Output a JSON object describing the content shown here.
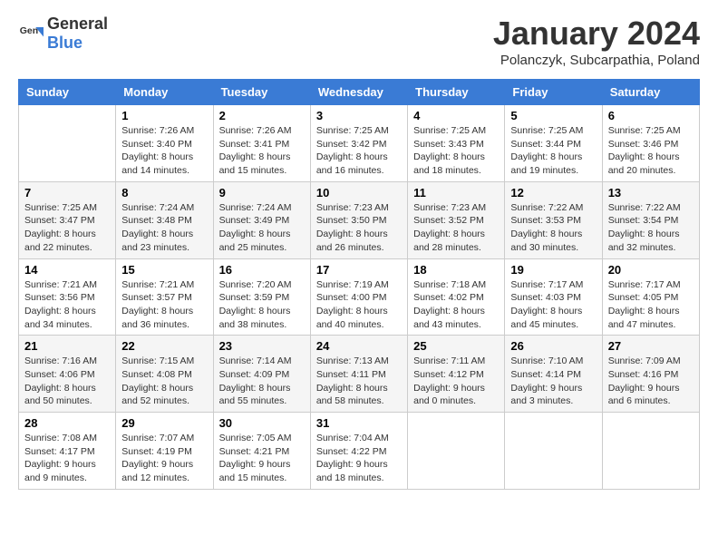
{
  "logo": {
    "general": "General",
    "blue": "Blue"
  },
  "title": {
    "month": "January 2024",
    "location": "Polanczyk, Subcarpathia, Poland"
  },
  "weekdays": [
    "Sunday",
    "Monday",
    "Tuesday",
    "Wednesday",
    "Thursday",
    "Friday",
    "Saturday"
  ],
  "weeks": [
    [
      {
        "day": "",
        "sunrise": "",
        "sunset": "",
        "daylight": ""
      },
      {
        "day": "1",
        "sunrise": "Sunrise: 7:26 AM",
        "sunset": "Sunset: 3:40 PM",
        "daylight": "Daylight: 8 hours and 14 minutes."
      },
      {
        "day": "2",
        "sunrise": "Sunrise: 7:26 AM",
        "sunset": "Sunset: 3:41 PM",
        "daylight": "Daylight: 8 hours and 15 minutes."
      },
      {
        "day": "3",
        "sunrise": "Sunrise: 7:25 AM",
        "sunset": "Sunset: 3:42 PM",
        "daylight": "Daylight: 8 hours and 16 minutes."
      },
      {
        "day": "4",
        "sunrise": "Sunrise: 7:25 AM",
        "sunset": "Sunset: 3:43 PM",
        "daylight": "Daylight: 8 hours and 18 minutes."
      },
      {
        "day": "5",
        "sunrise": "Sunrise: 7:25 AM",
        "sunset": "Sunset: 3:44 PM",
        "daylight": "Daylight: 8 hours and 19 minutes."
      },
      {
        "day": "6",
        "sunrise": "Sunrise: 7:25 AM",
        "sunset": "Sunset: 3:46 PM",
        "daylight": "Daylight: 8 hours and 20 minutes."
      }
    ],
    [
      {
        "day": "7",
        "sunrise": "Sunrise: 7:25 AM",
        "sunset": "Sunset: 3:47 PM",
        "daylight": "Daylight: 8 hours and 22 minutes."
      },
      {
        "day": "8",
        "sunrise": "Sunrise: 7:24 AM",
        "sunset": "Sunset: 3:48 PM",
        "daylight": "Daylight: 8 hours and 23 minutes."
      },
      {
        "day": "9",
        "sunrise": "Sunrise: 7:24 AM",
        "sunset": "Sunset: 3:49 PM",
        "daylight": "Daylight: 8 hours and 25 minutes."
      },
      {
        "day": "10",
        "sunrise": "Sunrise: 7:23 AM",
        "sunset": "Sunset: 3:50 PM",
        "daylight": "Daylight: 8 hours and 26 minutes."
      },
      {
        "day": "11",
        "sunrise": "Sunrise: 7:23 AM",
        "sunset": "Sunset: 3:52 PM",
        "daylight": "Daylight: 8 hours and 28 minutes."
      },
      {
        "day": "12",
        "sunrise": "Sunrise: 7:22 AM",
        "sunset": "Sunset: 3:53 PM",
        "daylight": "Daylight: 8 hours and 30 minutes."
      },
      {
        "day": "13",
        "sunrise": "Sunrise: 7:22 AM",
        "sunset": "Sunset: 3:54 PM",
        "daylight": "Daylight: 8 hours and 32 minutes."
      }
    ],
    [
      {
        "day": "14",
        "sunrise": "Sunrise: 7:21 AM",
        "sunset": "Sunset: 3:56 PM",
        "daylight": "Daylight: 8 hours and 34 minutes."
      },
      {
        "day": "15",
        "sunrise": "Sunrise: 7:21 AM",
        "sunset": "Sunset: 3:57 PM",
        "daylight": "Daylight: 8 hours and 36 minutes."
      },
      {
        "day": "16",
        "sunrise": "Sunrise: 7:20 AM",
        "sunset": "Sunset: 3:59 PM",
        "daylight": "Daylight: 8 hours and 38 minutes."
      },
      {
        "day": "17",
        "sunrise": "Sunrise: 7:19 AM",
        "sunset": "Sunset: 4:00 PM",
        "daylight": "Daylight: 8 hours and 40 minutes."
      },
      {
        "day": "18",
        "sunrise": "Sunrise: 7:18 AM",
        "sunset": "Sunset: 4:02 PM",
        "daylight": "Daylight: 8 hours and 43 minutes."
      },
      {
        "day": "19",
        "sunrise": "Sunrise: 7:17 AM",
        "sunset": "Sunset: 4:03 PM",
        "daylight": "Daylight: 8 hours and 45 minutes."
      },
      {
        "day": "20",
        "sunrise": "Sunrise: 7:17 AM",
        "sunset": "Sunset: 4:05 PM",
        "daylight": "Daylight: 8 hours and 47 minutes."
      }
    ],
    [
      {
        "day": "21",
        "sunrise": "Sunrise: 7:16 AM",
        "sunset": "Sunset: 4:06 PM",
        "daylight": "Daylight: 8 hours and 50 minutes."
      },
      {
        "day": "22",
        "sunrise": "Sunrise: 7:15 AM",
        "sunset": "Sunset: 4:08 PM",
        "daylight": "Daylight: 8 hours and 52 minutes."
      },
      {
        "day": "23",
        "sunrise": "Sunrise: 7:14 AM",
        "sunset": "Sunset: 4:09 PM",
        "daylight": "Daylight: 8 hours and 55 minutes."
      },
      {
        "day": "24",
        "sunrise": "Sunrise: 7:13 AM",
        "sunset": "Sunset: 4:11 PM",
        "daylight": "Daylight: 8 hours and 58 minutes."
      },
      {
        "day": "25",
        "sunrise": "Sunrise: 7:11 AM",
        "sunset": "Sunset: 4:12 PM",
        "daylight": "Daylight: 9 hours and 0 minutes."
      },
      {
        "day": "26",
        "sunrise": "Sunrise: 7:10 AM",
        "sunset": "Sunset: 4:14 PM",
        "daylight": "Daylight: 9 hours and 3 minutes."
      },
      {
        "day": "27",
        "sunrise": "Sunrise: 7:09 AM",
        "sunset": "Sunset: 4:16 PM",
        "daylight": "Daylight: 9 hours and 6 minutes."
      }
    ],
    [
      {
        "day": "28",
        "sunrise": "Sunrise: 7:08 AM",
        "sunset": "Sunset: 4:17 PM",
        "daylight": "Daylight: 9 hours and 9 minutes."
      },
      {
        "day": "29",
        "sunrise": "Sunrise: 7:07 AM",
        "sunset": "Sunset: 4:19 PM",
        "daylight": "Daylight: 9 hours and 12 minutes."
      },
      {
        "day": "30",
        "sunrise": "Sunrise: 7:05 AM",
        "sunset": "Sunset: 4:21 PM",
        "daylight": "Daylight: 9 hours and 15 minutes."
      },
      {
        "day": "31",
        "sunrise": "Sunrise: 7:04 AM",
        "sunset": "Sunset: 4:22 PM",
        "daylight": "Daylight: 9 hours and 18 minutes."
      },
      {
        "day": "",
        "sunrise": "",
        "sunset": "",
        "daylight": ""
      },
      {
        "day": "",
        "sunrise": "",
        "sunset": "",
        "daylight": ""
      },
      {
        "day": "",
        "sunrise": "",
        "sunset": "",
        "daylight": ""
      }
    ]
  ]
}
